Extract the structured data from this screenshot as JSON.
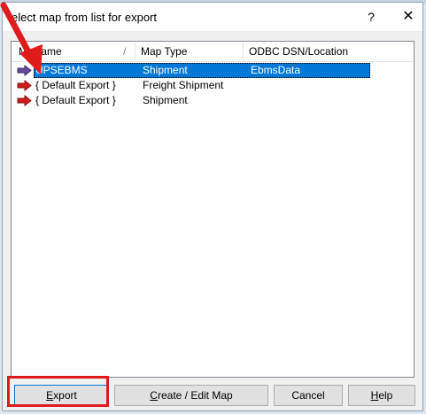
{
  "dialog": {
    "title": "elect map from list for export",
    "help_glyph": "?",
    "close_glyph": "✕"
  },
  "list": {
    "columns": [
      "Ma",
      "Name",
      "Map Type",
      "ODBC DSN/Location"
    ],
    "sort_marker": "/",
    "rows": [
      {
        "name": "UPSEBMS",
        "map_type": "Shipment",
        "location": "EbmsData",
        "selected": true
      },
      {
        "name": "{ Default Export }",
        "map_type": "Freight Shipment",
        "location": "",
        "selected": false
      },
      {
        "name": "{ Default Export }",
        "map_type": "Shipment",
        "location": "",
        "selected": false
      }
    ]
  },
  "buttons": {
    "export": {
      "pre": "",
      "mnemonic": "E",
      "post": "xport"
    },
    "create": {
      "pre": "",
      "mnemonic": "C",
      "post": "reate / Edit Map"
    },
    "cancel": {
      "label": "Cancel"
    },
    "help": {
      "pre": "",
      "mnemonic": "H",
      "post": "elp"
    }
  },
  "colors": {
    "selection": "#0078d7",
    "annotation_red": "#e01b1b",
    "row_arrow_red": "#d21b1b",
    "row_arrow_purple": "#6a4a9a"
  },
  "icons": {
    "row_marker": "arrow-right-icon",
    "annotation": "red-arrow-annotation",
    "close": "close-icon",
    "help": "help-icon"
  }
}
